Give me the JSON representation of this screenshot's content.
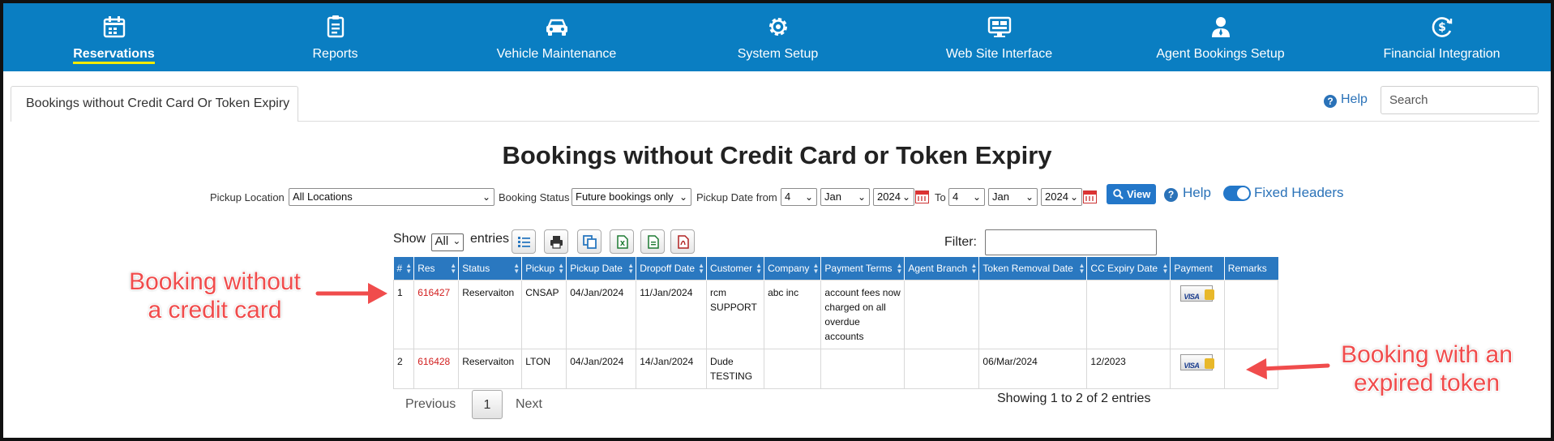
{
  "nav": [
    {
      "label": "Reservations",
      "icon": "calendar-icon",
      "active": true
    },
    {
      "label": "Reports",
      "icon": "clipboard-icon"
    },
    {
      "label": "Vehicle Maintenance",
      "icon": "car-icon"
    },
    {
      "label": "System Setup",
      "icon": "gear-icon"
    },
    {
      "label": "Web Site Interface",
      "icon": "monitor-icon"
    },
    {
      "label": "Agent Bookings Setup",
      "icon": "agent-icon"
    },
    {
      "label": "Financial Integration",
      "icon": "dollar-cycle-icon"
    }
  ],
  "tab": {
    "label": "Bookings without Credit Card Or Token Expiry"
  },
  "top_help": "Help",
  "search": {
    "placeholder": "Search",
    "value": ""
  },
  "title": "Bookings without Credit Card or Token Expiry",
  "filters": {
    "pickup_location_label": "Pickup Location",
    "pickup_location_value": "All Locations",
    "booking_status_label": "Booking Status",
    "booking_status_value": "Future bookings only",
    "pickup_date_from_label": "Pickup Date from",
    "from_day": "4",
    "from_month": "Jan",
    "from_year": "2024",
    "to_label": "To",
    "to_day": "4",
    "to_month": "Jan",
    "to_year": "2024",
    "view_label": "View",
    "help_label": "Help",
    "fixed_headers_label": "Fixed Headers"
  },
  "table_controls": {
    "show_label": "Show",
    "show_value": "All",
    "entries_label": "entries",
    "filter_label": "Filter:"
  },
  "table": {
    "columns": [
      "#",
      "Res",
      "Status",
      "Pickup",
      "Pickup Date",
      "Dropoff Date",
      "Customer",
      "Company",
      "Payment Terms",
      "Agent Branch",
      "Token Removal Date",
      "CC Expiry Date",
      "Payment",
      "Remarks"
    ],
    "rows": [
      {
        "num": "1",
        "res": "616427",
        "status": "Reservaiton",
        "pickup": "CNSAP",
        "pickup_date": "04/Jan/2024",
        "dropoff_date": "11/Jan/2024",
        "customer": "rcm SUPPORT",
        "company": "abc inc",
        "payment_terms": "account fees now charged on all overdue accounts",
        "agent_branch": "",
        "token_removal": "",
        "cc_expiry": "",
        "remarks": ""
      },
      {
        "num": "2",
        "res": "616428",
        "status": "Reservaiton",
        "pickup": "LTON",
        "pickup_date": "04/Jan/2024",
        "dropoff_date": "14/Jan/2024",
        "customer": "Dude TESTING",
        "company": "",
        "payment_terms": "",
        "agent_branch": "",
        "token_removal": "06/Mar/2024",
        "cc_expiry": "12/2023",
        "remarks": ""
      }
    ]
  },
  "pagination": {
    "previous": "Previous",
    "page": "1",
    "next": "Next",
    "showing": "Showing 1 to 2 of 2 entries"
  },
  "annotations": {
    "left_line1": "Booking without",
    "left_line2": "a credit card",
    "right_line1": "Booking with an",
    "right_line2": "expired token"
  },
  "colors": {
    "nav_bg": "#0a7ec2",
    "header_bg": "#2a78c0",
    "res_link": "#d21f1f",
    "callout": "#f04c4c"
  }
}
